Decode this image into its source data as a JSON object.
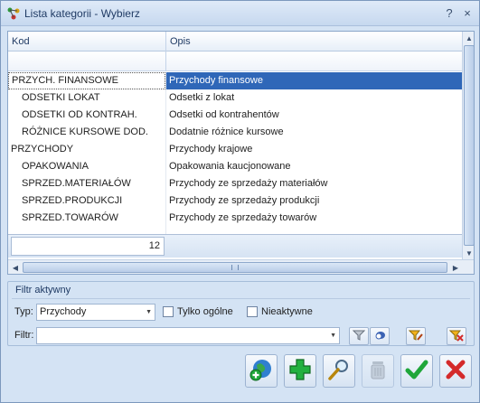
{
  "window": {
    "title": "Lista kategorii - Wybierz"
  },
  "titlebar_buttons": {
    "help": "?",
    "close": "×"
  },
  "grid": {
    "columns": [
      {
        "label": "Kod"
      },
      {
        "label": "Opis"
      }
    ],
    "rows": [
      {
        "kod": "PRZYCH. FINANSOWE",
        "opis": "Przychody finansowe",
        "level": 0,
        "selected": true
      },
      {
        "kod": "ODSETKI LOKAT",
        "opis": "Odsetki z lokat",
        "level": 1
      },
      {
        "kod": "ODSETKI OD KONTRAH.",
        "opis": "Odsetki od kontrahentów",
        "level": 1
      },
      {
        "kod": "RÓŻNICE KURSOWE DOD.",
        "opis": "Dodatnie różnice kursowe",
        "level": 1
      },
      {
        "kod": "PRZYCHODY",
        "opis": "Przychody krajowe",
        "level": 0
      },
      {
        "kod": "OPAKOWANIA",
        "opis": "Opakowania kaucjonowane",
        "level": 1
      },
      {
        "kod": "SPRZED.MATERIAŁÓW",
        "opis": "Przychody ze sprzedaży materiałów",
        "level": 1
      },
      {
        "kod": "SPRZED.PRODUKCJI",
        "opis": "Przychody ze sprzedaży produkcji",
        "level": 1
      },
      {
        "kod": "SPRZED.TOWARÓW",
        "opis": "Przychody ze sprzedaży towarów",
        "level": 1
      }
    ],
    "count": "12"
  },
  "filter_panel": {
    "title": "Filtr aktywny",
    "typ_label": "Typ:",
    "typ_value": "Przychody",
    "only_general_label": "Tylko ogólne",
    "inactive_label": "Nieaktywne",
    "filter_label": "Filtr:",
    "filter_value": ""
  },
  "colors": {
    "selection": "#2f67b8",
    "window_bg": "#d4e3f4",
    "add_green": "#1fa63a",
    "cancel_red": "#d42a2a"
  },
  "icons": {
    "app": "tree-categories-icon",
    "filter": "funnel-icon",
    "clear_filter": "clear-filter-icon",
    "web": "globe-add-icon",
    "add": "plus-icon",
    "edit": "magnifier-icon",
    "delete": "trash-icon",
    "confirm": "checkmark-icon",
    "cancel": "x-icon"
  }
}
